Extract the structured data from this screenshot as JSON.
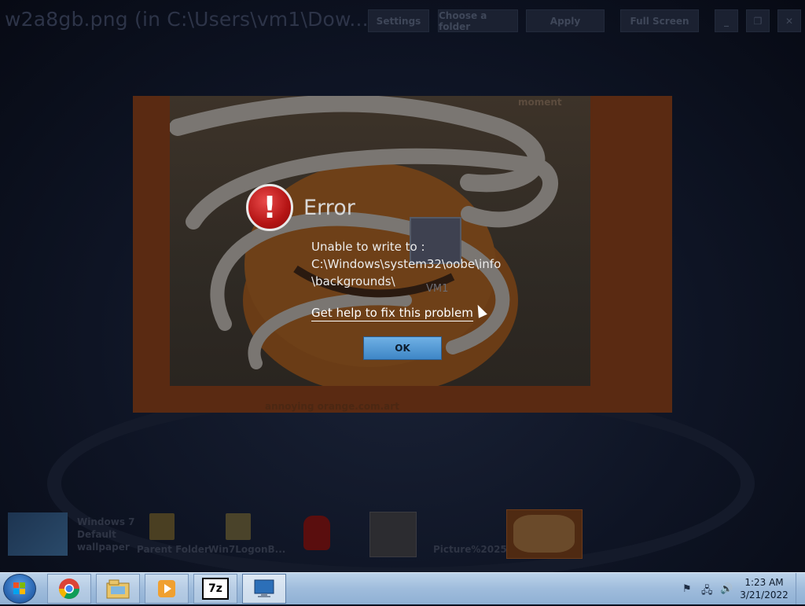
{
  "window": {
    "title": "w2a8gb.png (in C:\\Users\\vm1\\Dow...",
    "buttons": {
      "settings": "Settings",
      "choose_folder": "Choose a folder",
      "apply": "Apply",
      "full_screen": "Full Screen",
      "minimize": "_",
      "restore": "❐",
      "close": "✕"
    }
  },
  "preview": {
    "top_caption": "moment",
    "bottom_caption": "annoying orange.com.art",
    "overlay_label": "VM1"
  },
  "error_dialog": {
    "title": "Error",
    "message": "Unable to write to :\nC:\\Windows\\system32\\oobe\\info\n\\backgrounds\\",
    "help_link": "Get help to fix this problem",
    "ok_label": "OK"
  },
  "thumbnails": [
    {
      "label": "Windows 7\nDefault\nwallpaper",
      "icon": "wallpaper-thumb"
    },
    {
      "label": "Parent Folder",
      "icon": "folder-up-icon"
    },
    {
      "label": "Win7LogonB...",
      "icon": "folder-icon"
    },
    {
      "label": "",
      "icon": "among-us-icon"
    },
    {
      "label": "",
      "icon": "sprite-sheet-thumb"
    },
    {
      "label": "Picture%2025...",
      "icon": "picture-thumb"
    },
    {
      "label": "",
      "icon": "selected-orange-thumb"
    }
  ],
  "taskbar": {
    "apps": [
      "chrome-icon",
      "explorer-icon",
      "media-player-icon",
      "7zip-icon",
      "computer-icon"
    ],
    "time": "1:23 AM",
    "date": "3/21/2022",
    "app_7zip_text": "7z"
  },
  "colors": {
    "accent": "#3e86c6",
    "error_red": "#b41414",
    "taskbar": "#9fbcdc"
  }
}
